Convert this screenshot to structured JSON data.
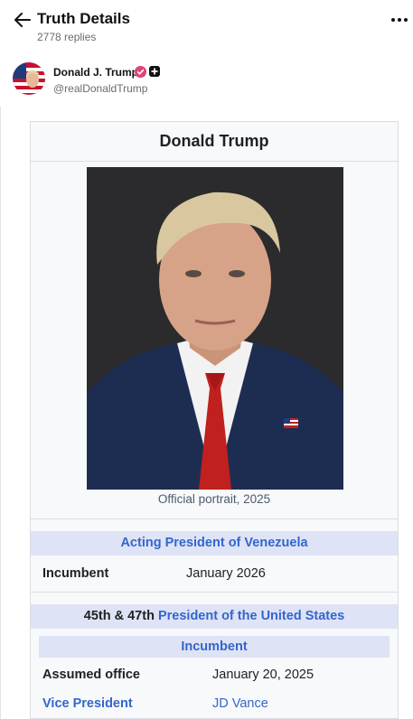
{
  "header": {
    "title": "Truth Details",
    "replies": "2778 replies"
  },
  "post": {
    "author_name": "Donald J. Trump",
    "handle": "@realDonaldTrump"
  },
  "infobox": {
    "title": "Donald Trump",
    "caption": "Official portrait, 2025",
    "acting_office": {
      "title": "Acting President of Venezuela",
      "incumbent_label": "Incumbent",
      "incumbent_value": "January 2026"
    },
    "us_office": {
      "ordinal": "45th & 47th",
      "office_link": "President of the United States",
      "incumbent_band": "Incumbent",
      "assumed_label": "Assumed office",
      "assumed_value": "January 20, 2025",
      "vp_label": "Vice President",
      "vp_value": "JD Vance"
    }
  },
  "colors": {
    "link": "#3366cc",
    "band": "#dfe3f6",
    "verified": "#e0457b"
  }
}
